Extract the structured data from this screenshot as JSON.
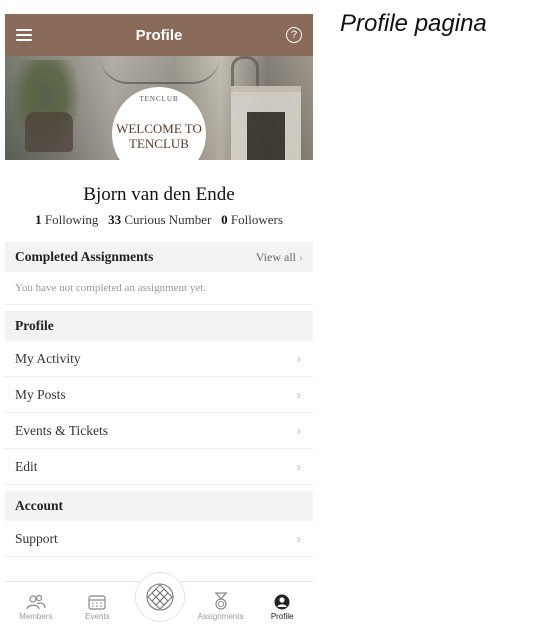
{
  "caption": "Profile pagina",
  "topbar": {
    "title": "Profile",
    "help_symbol": "?"
  },
  "banner": {
    "logo_top": "TENCLUB",
    "logo_welcome": "WELCOME TO TENCLUB"
  },
  "profile": {
    "name": "Bjorn van den Ende",
    "following_count": "1",
    "following_label": "Following",
    "curious_count": "33",
    "curious_label": "Curious Number",
    "followers_count": "0",
    "followers_label": "Followers"
  },
  "assignments": {
    "header": "Completed Assignments",
    "view_all": "View all",
    "empty": "You have not completed an assignment yet."
  },
  "profile_section": {
    "header": "Profile",
    "items": [
      {
        "label": "My Activity"
      },
      {
        "label": "My Posts"
      },
      {
        "label": "Events & Tickets"
      },
      {
        "label": "Edit"
      }
    ]
  },
  "account_section": {
    "header": "Account",
    "items": [
      {
        "label": "Support"
      }
    ]
  },
  "bottom_nav": {
    "items": [
      {
        "label": "Members",
        "icon": "members-icon"
      },
      {
        "label": "Events",
        "icon": "calendar-icon"
      },
      {
        "label": "",
        "icon": "tenclub-logo-icon"
      },
      {
        "label": "Assignments",
        "icon": "medal-icon"
      },
      {
        "label": "Profile",
        "icon": "profile-icon",
        "active": true
      }
    ]
  },
  "colors": {
    "topbar": "#8a6b59",
    "logo_text": "#5a3a2c",
    "section_bg": "#f3f3f3"
  }
}
